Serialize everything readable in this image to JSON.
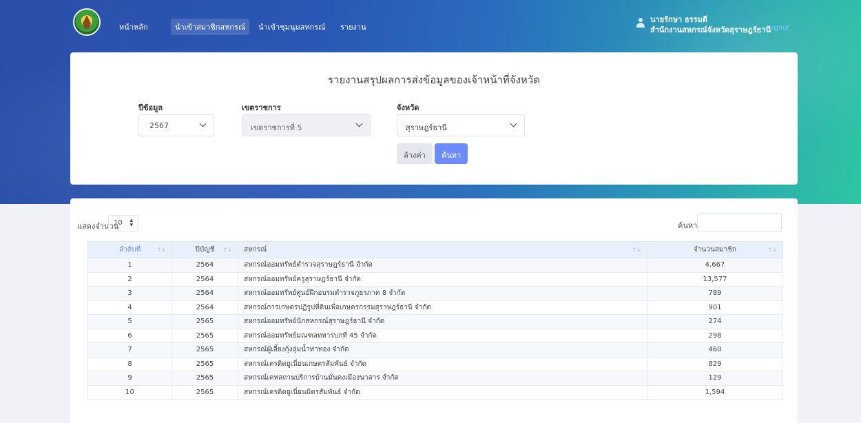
{
  "nav": {
    "home": "หน้าหลัก",
    "import_members": "นำเข้าสมาชิกสหกรณ์",
    "import_groups": "นำเข้าชุมนุมสหกรณ์",
    "report": "รายงาน"
  },
  "user": {
    "name": "นายรักษา ธรรมดี",
    "org": "สำนักงานสหกรณ์จังหวัดสุราษฎร์ธานี",
    "logout": "Logout"
  },
  "filter": {
    "title": "รายงานสรุปผลการส่งข้อมูลของเจ้าหน้าที่จังหวัด",
    "year_label": "ปีข้อมูล",
    "year_value": "2567",
    "region_label": "เขตราชการ",
    "region_value": "เขตราชการที่ 5",
    "province_label": "จังหวัด",
    "province_value": "สุราษฎร์ธานี",
    "reset_label": "ล้างค่า",
    "search_label": "ค้นหา"
  },
  "table": {
    "length_label": "แสดงจำนวน",
    "length_value": "10",
    "search_label": "ค้นหา:",
    "columns": [
      "ลำดับที่",
      "ปีบัญชี",
      "สหกรณ์",
      "จำนวนสมาชิก"
    ],
    "rows": [
      [
        "1",
        "2564",
        "สหกรณ์ออมทรัพย์ตำรวจสุราษฎร์ธานี จำกัด",
        "4,667"
      ],
      [
        "2",
        "2564",
        "สหกรณ์ออมทรัพย์ครูสุราษฎร์ธานี จำกัด",
        "13,577"
      ],
      [
        "3",
        "2564",
        "สหกรณ์ออมทรัพย์ศูนย์ฝึกอบรมตำรวจภูธรภาค 8 จำกัด",
        "789"
      ],
      [
        "4",
        "2564",
        "สหกรณ์การเกษตรปฏิรูปที่ดินเพื่อเกษตรกรรมสุราษฎร์ธานี จำกัด",
        "901"
      ],
      [
        "5",
        "2565",
        "สหกรณ์ออมทรัพย์นักสหกรณ์สุราษฎร์ธานี จำกัด",
        "274"
      ],
      [
        "6",
        "2565",
        "สหกรณ์ออมทรัพย์มณฑลทหารบกที่ 45 จำกัด",
        "298"
      ],
      [
        "7",
        "2565",
        "สหกรณ์ผู้เลี้ยงกุ้งลุ่มน้ำท่าทอง จำกัด",
        "460"
      ],
      [
        "8",
        "2565",
        "สหกรณ์เครดิตยูเนี่ยนเกษตรสัมพันธ์ จำกัด",
        "829"
      ],
      [
        "9",
        "2565",
        "สหกรณ์เคหสถานบริการบ้านมั่นคงเมืองนาสาร จำกัด",
        "129"
      ],
      [
        "10",
        "2565",
        "สหกรณ์เครดิตยูเนี่ยนมิตรสัมพันธ์ จำกัด",
        "1,594"
      ]
    ]
  },
  "colors": {
    "accent": "#6d8bfb",
    "header_row": "#e8f0fb",
    "banner_start": "#2b4fa8",
    "banner_end": "#2fc6a3"
  },
  "icons": [
    "logo-emblem",
    "user-icon",
    "chevron-down-icon",
    "sort-icon",
    "stepper-arrows-icon"
  ]
}
